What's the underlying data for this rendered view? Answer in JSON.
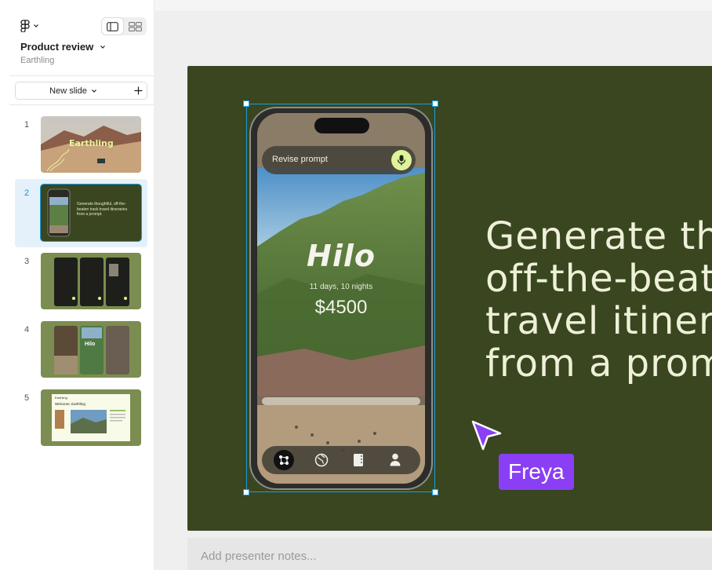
{
  "sidebar": {
    "file_title": "Product review",
    "file_subtitle": "Earthling",
    "new_slide_label": "New slide",
    "slides": [
      {
        "num": "1",
        "thumb_title": "Earthling"
      },
      {
        "num": "2",
        "thumb_text": "Generate thoughtful, off-the-beaten track travel itineraries from a prompt."
      },
      {
        "num": "3"
      },
      {
        "num": "4",
        "thumb_title": "Hilo"
      },
      {
        "num": "5",
        "thumb_title": "Earthling",
        "thumb_subtitle": "Welcome, Earthling"
      }
    ]
  },
  "slide": {
    "headline_lines": [
      "Generate tho",
      "off-the-beat",
      "travel itinera",
      "from a promp"
    ],
    "phone": {
      "prompt_label": "Revise prompt",
      "brand": "Hilo",
      "trip_duration": "11 days, 10 nights",
      "price": "$4500"
    }
  },
  "collaborator": {
    "name": "Freya",
    "color": "#8a3ff5"
  },
  "notes": {
    "placeholder": "Add presenter notes..."
  },
  "colors": {
    "slide_bg": "#394620",
    "selection": "#1a9ee6",
    "accent_lime": "#dff39a"
  }
}
